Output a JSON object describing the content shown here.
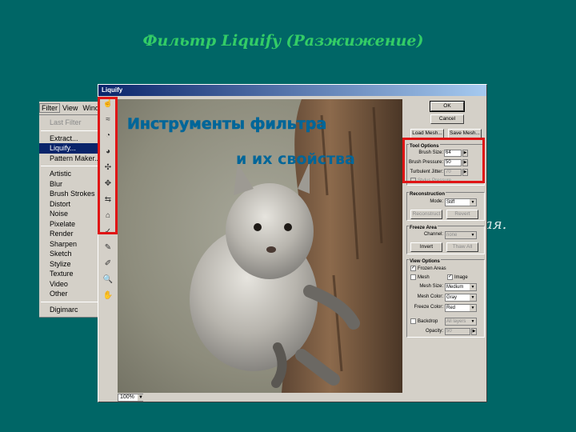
{
  "slide": {
    "title": "Фильтр Liquify (Разжижение)",
    "hidden_caption": "ая."
  },
  "menu": {
    "bar": [
      "Filter",
      "View",
      "Wind"
    ],
    "items": [
      {
        "label": "Last Filter",
        "state": "disabled"
      },
      {
        "label": "Extract...",
        "state": "normal"
      },
      {
        "label": "Liquify...",
        "state": "selected"
      },
      {
        "label": "Pattern Maker...",
        "state": "normal"
      },
      {
        "label": "Artistic"
      },
      {
        "label": "Blur"
      },
      {
        "label": "Brush Strokes"
      },
      {
        "label": "Distort"
      },
      {
        "label": "Noise"
      },
      {
        "label": "Pixelate"
      },
      {
        "label": "Render"
      },
      {
        "label": "Sharpen"
      },
      {
        "label": "Sketch"
      },
      {
        "label": "Stylize"
      },
      {
        "label": "Texture"
      },
      {
        "label": "Video"
      },
      {
        "label": "Other"
      },
      {
        "label": "Digimarc"
      }
    ]
  },
  "dialog": {
    "title": "Liquify",
    "overlay_line1": "Инструменты фильтра",
    "overlay_line2": "и их свойства",
    "zoom": "100%",
    "tools": [
      "warp-tool-icon",
      "turbulence-tool-icon",
      "twirl-cw-tool-icon",
      "twirl-ccw-tool-icon",
      "pucker-tool-icon",
      "bloat-tool-icon",
      "shift-pixels-tool-icon",
      "reflection-tool-icon",
      "reconstruct-tool-icon",
      "freeze-tool-icon",
      "thaw-tool-icon",
      "zoom-tool-icon",
      "hand-tool-icon"
    ],
    "buttons": {
      "ok": "OK",
      "cancel": "Cancel",
      "load_mesh": "Load Mesh...",
      "save_mesh": "Save Mesh..."
    },
    "tool_options": {
      "title": "Tool Options",
      "brush_size_label": "Brush Size:",
      "brush_size": "64",
      "brush_pressure_label": "Brush Pressure:",
      "brush_pressure": "50",
      "turbulent_jitter_label": "Turbulent Jitter:",
      "turbulent_jitter": "70",
      "stylus_pressure": "Stylus Pressure"
    },
    "reconstruction": {
      "title": "Reconstruction",
      "mode_label": "Mode:",
      "mode": "Stiff",
      "reconstruct": "Reconstruct",
      "revert": "Revert"
    },
    "freeze_area": {
      "title": "Freeze Area",
      "channel_label": "Channel:",
      "channel": "none",
      "invert": "Invert",
      "thaw_all": "Thaw All"
    },
    "view_options": {
      "title": "View Options",
      "frozen_areas": "Frozen Areas",
      "mesh": "Mesh",
      "image": "Image",
      "mesh_size_label": "Mesh Size:",
      "mesh_size": "Medium",
      "mesh_color_label": "Mesh Color:",
      "mesh_color": "Gray",
      "freeze_color_label": "Freeze Color:",
      "freeze_color": "Red",
      "backdrop": "Backdrop",
      "backdrop_value": "All layers",
      "opacity_label": "Opacity:",
      "opacity": "50"
    }
  },
  "colors": {
    "slide_bg": "#006666",
    "title": "#33cc66",
    "highlight": "#e01515",
    "overlay_text": "#006699",
    "selection": "#0a246a"
  }
}
